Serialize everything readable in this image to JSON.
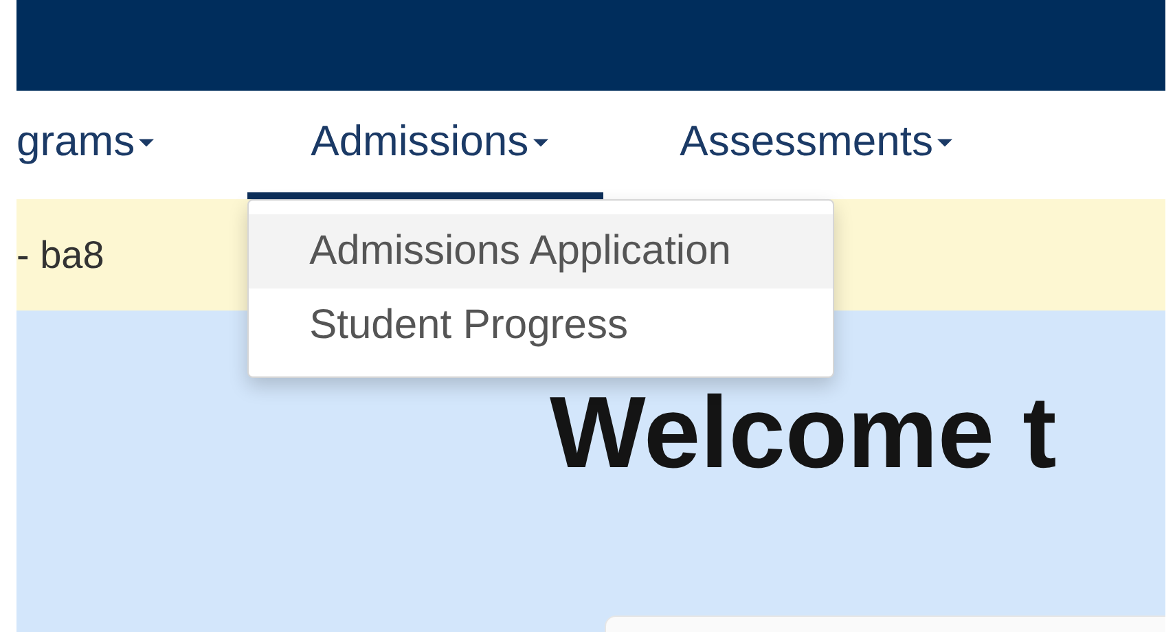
{
  "nav": {
    "tabs": [
      {
        "label": "grams",
        "selected": false
      },
      {
        "label": "Admissions",
        "selected": true,
        "menu": [
          {
            "label": "Admissions Application",
            "selected": true
          },
          {
            "label": "Student Progress",
            "selected": false
          }
        ]
      },
      {
        "label": "Assessments",
        "selected": false
      }
    ]
  },
  "banner": {
    "text": "- ba8"
  },
  "main": {
    "title": "Welcome t"
  }
}
